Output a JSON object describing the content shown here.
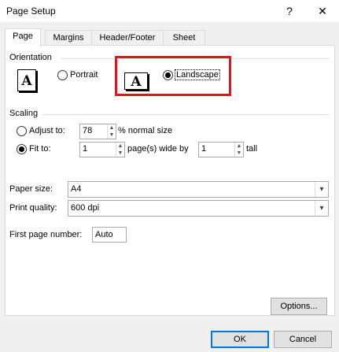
{
  "window": {
    "title": "Page Setup",
    "help_glyph": "?",
    "close_glyph": "✕"
  },
  "tabs": [
    {
      "label": "Page"
    },
    {
      "label": "Margins"
    },
    {
      "label": "Header/Footer"
    },
    {
      "label": "Sheet"
    }
  ],
  "orientation": {
    "heading": "Orientation",
    "portrait_label": "Portrait",
    "landscape_label": "Landscape",
    "selected": "landscape",
    "icon_letter": "A"
  },
  "scaling": {
    "heading": "Scaling",
    "adjust_to_label": "Adjust to:",
    "adjust_to_value": "78",
    "normal_size_label": "% normal size",
    "fit_to_label": "Fit to:",
    "fit_wide_value": "1",
    "pages_wide_label": "page(s) wide by",
    "fit_tall_value": "1",
    "tall_label": "tall",
    "selected": "fit_to"
  },
  "paper_size": {
    "label": "Paper size:",
    "value": "A4"
  },
  "print_quality": {
    "label": "Print quality:",
    "value": "600 dpi"
  },
  "first_page_number": {
    "label": "First page number:",
    "value": "Auto"
  },
  "buttons": {
    "options": "Options...",
    "ok": "OK",
    "cancel": "Cancel"
  },
  "colors": {
    "highlight": "#e0161c",
    "default_button_border": "#0078d7"
  }
}
